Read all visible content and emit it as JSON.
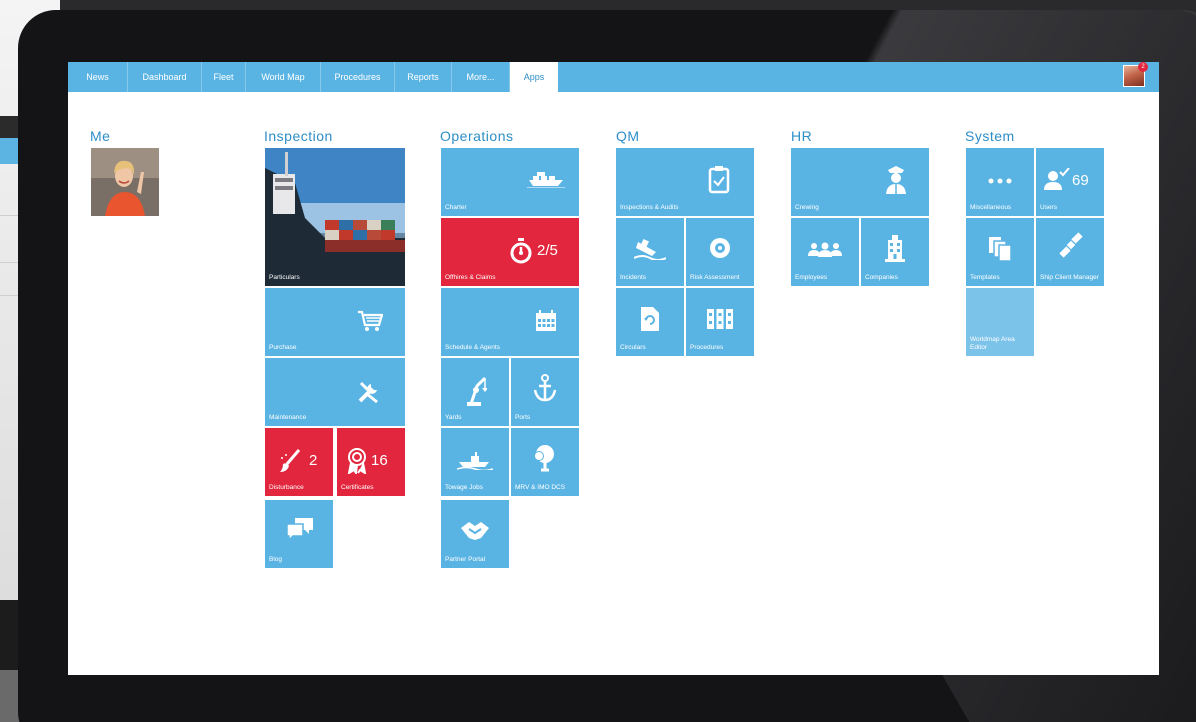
{
  "nav": {
    "tabs": [
      "News",
      "Dashboard",
      "Fleet",
      "World Map",
      "Procedures",
      "Reports",
      "More...",
      "Apps"
    ],
    "active": "Apps",
    "avatar_badge": "2"
  },
  "sections": {
    "me": "Me",
    "inspection": "Inspection",
    "operations": "Operations",
    "qm": "QM",
    "hr": "HR",
    "system": "System"
  },
  "tiles": {
    "particulars": "Particulars",
    "purchase": "Purchase",
    "maintenance": "Maintenance",
    "disturbance": "Disturbance",
    "disturbance_count": "2",
    "certificates": "Certificates",
    "certificates_count": "16",
    "blog": "Blog",
    "charter": "Charter",
    "offhires": "Offhires & Claims",
    "offhires_count": "2/5",
    "schedule": "Schedule & Agents",
    "yards": "Yards",
    "ports": "Ports",
    "towage": "Towage Jobs",
    "mrv": "MRV & IMO DCS",
    "partner": "Partner Portal",
    "inspections_audits": "Inspections & Audits",
    "incidents": "Incidents",
    "risk": "Risk Assessment",
    "circulars": "Circulars",
    "procedures": "Procedures",
    "crewing": "Crewing",
    "employees": "Employees",
    "companies": "Companies",
    "misc": "Miscellaneous",
    "users": "Users",
    "users_count": "69",
    "templates": "Templates",
    "ship_client": "Ship Client Manager",
    "worldmap_editor": "Worldmap Area Editor"
  },
  "colors": {
    "accent": "#5ab4e3",
    "alert": "#e2263d",
    "heading": "#2e8ec7"
  },
  "icons": {
    "charter": "ship-icon",
    "offhires": "stopwatch-icon",
    "schedule": "calendar-icon",
    "purchase": "cart-icon",
    "maintenance": "tools-icon",
    "disturbance": "brush-icon",
    "certificates": "award-icon",
    "blog": "chat-icon"
  }
}
